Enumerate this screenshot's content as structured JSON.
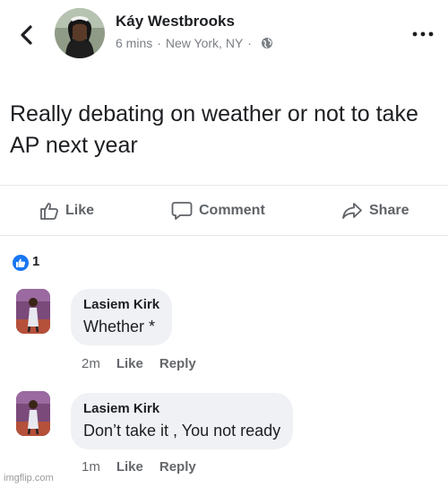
{
  "post": {
    "author": "Káy Westbrooks",
    "time": "6 mins",
    "separator": "·",
    "location": "New York, NY",
    "privacy_icon": "globe-icon",
    "text": "Really debating on weather or not to take AP next year"
  },
  "actions": {
    "like": "Like",
    "comment": "Comment",
    "share": "Share"
  },
  "reactions": {
    "count": "1",
    "type": "like",
    "color": "#1877f2"
  },
  "comments": [
    {
      "name": "Lasiem Kirk",
      "text": "Whether *",
      "time": "2m",
      "like": "Like",
      "reply": "Reply"
    },
    {
      "name": "Lasiem Kirk",
      "text": "Don’t take it , You not ready",
      "time": "1m",
      "like": "Like",
      "reply": "Reply"
    }
  ],
  "watermark": "imgflip.com"
}
